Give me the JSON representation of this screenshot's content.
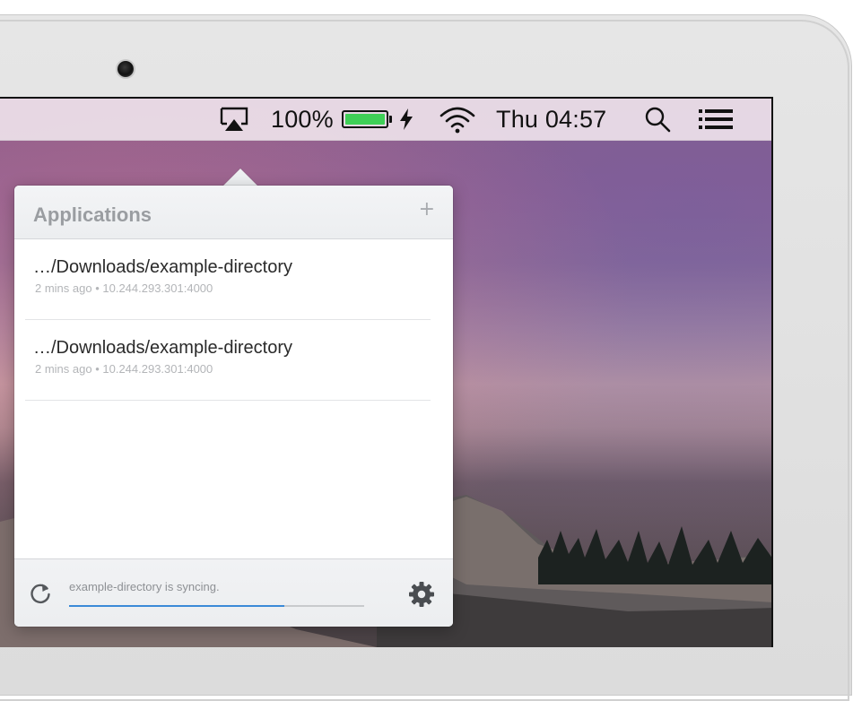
{
  "menubar": {
    "battery_percent": "100%",
    "battery_level": 1.0,
    "battery_color": "#3fcf57",
    "clock": "Thu 04:57",
    "icons": [
      "airplay-icon",
      "battery-icon",
      "charging-bolt-icon",
      "wifi-icon",
      "spotlight-search-icon",
      "menu-list-icon"
    ]
  },
  "popover": {
    "title": "Applications",
    "add_label": "+",
    "items": [
      {
        "path": "…/Downloads/example-directory",
        "meta": "2 mins ago • 10.244.293.301:4000"
      },
      {
        "path": "…/Downloads/example-directory",
        "meta": "2 mins ago • 10.244.293.301:4000"
      }
    ],
    "footer": {
      "status": "example-directory is syncing.",
      "progress": 0.73,
      "progress_color": "#3b8ad8",
      "icons": [
        "sync-icon",
        "gear-icon"
      ]
    }
  }
}
